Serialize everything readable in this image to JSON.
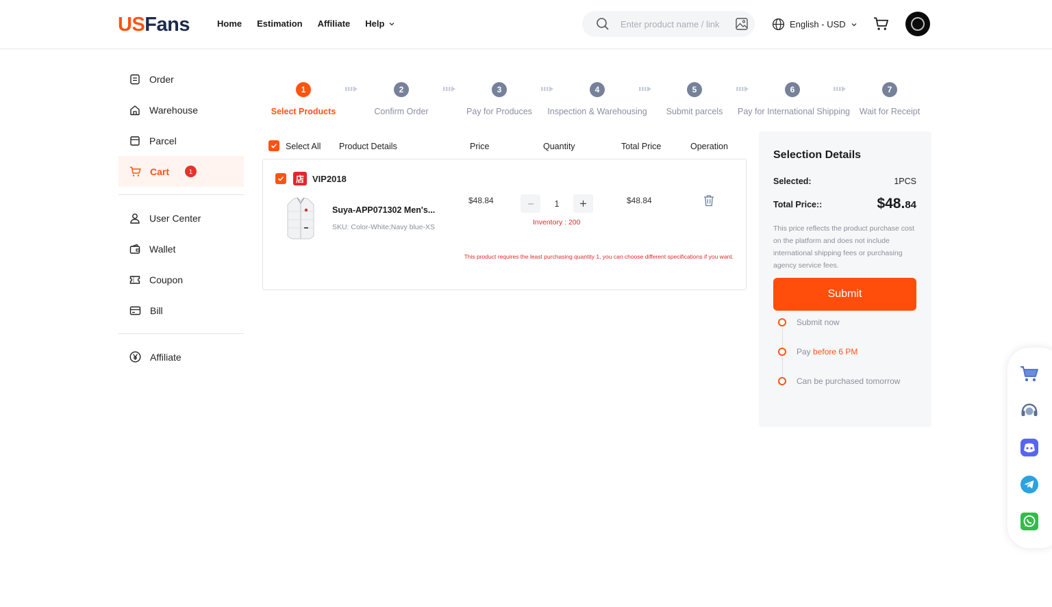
{
  "header": {
    "logo_us": "US",
    "logo_fans": "Fans",
    "nav": [
      "Home",
      "Estimation",
      "Affiliate",
      "Help"
    ],
    "search_placeholder": "Enter product name / link",
    "language": "English - USD"
  },
  "sidebar": {
    "group1": [
      "Order",
      "Warehouse",
      "Parcel",
      "Cart"
    ],
    "cart_badge": "1",
    "group2": [
      "User Center",
      "Wallet",
      "Coupon",
      "Bill"
    ],
    "group3": [
      "Affiliate"
    ]
  },
  "steps": [
    {
      "num": "1",
      "label": "Select Products"
    },
    {
      "num": "2",
      "label": "Confirm Order"
    },
    {
      "num": "3",
      "label": "Pay for Produces"
    },
    {
      "num": "4",
      "label": "Inspection & Warehousing"
    },
    {
      "num": "5",
      "label": "Submit parcels"
    },
    {
      "num": "6",
      "label": "Pay for International Shipping"
    },
    {
      "num": "7",
      "label": "Wait for Receipt"
    }
  ],
  "table": {
    "select_all": "Select All",
    "columns": [
      "Product Details",
      "Price",
      "Quantity",
      "Total Price",
      "Operation"
    ]
  },
  "cart": {
    "shop_icon": "店",
    "shop_name": "VIP2018",
    "product_name": "Suya-APP071302 Men's...",
    "sku": "SKU: Color-White;Navy blue-XS",
    "price": "$48.84",
    "quantity": "1",
    "inventory": "Inventory : 200",
    "total": "$48.84",
    "warning": "This product requires the least purchasing quantity 1, you can choose different specifications if you want."
  },
  "panel": {
    "title": "Selection Details",
    "selected_label": "Selected:",
    "selected_value": "1PCS",
    "total_label": "Total Price::",
    "total_main": "$48.",
    "total_cents": "84",
    "note": "This price reflects the product purchase cost on the platform and does not include international shipping fees or purchasing agency service fees.",
    "submit": "Submit",
    "timeline": [
      {
        "pre": "Submit now",
        "hl": ""
      },
      {
        "pre": "Pay ",
        "hl": "before 6 PM"
      },
      {
        "pre": "Can be purchased tomorrow",
        "hl": ""
      }
    ]
  },
  "colors": {
    "accent": "#ff5310",
    "danger": "#e3262e",
    "step_inactive": "#76819a"
  }
}
